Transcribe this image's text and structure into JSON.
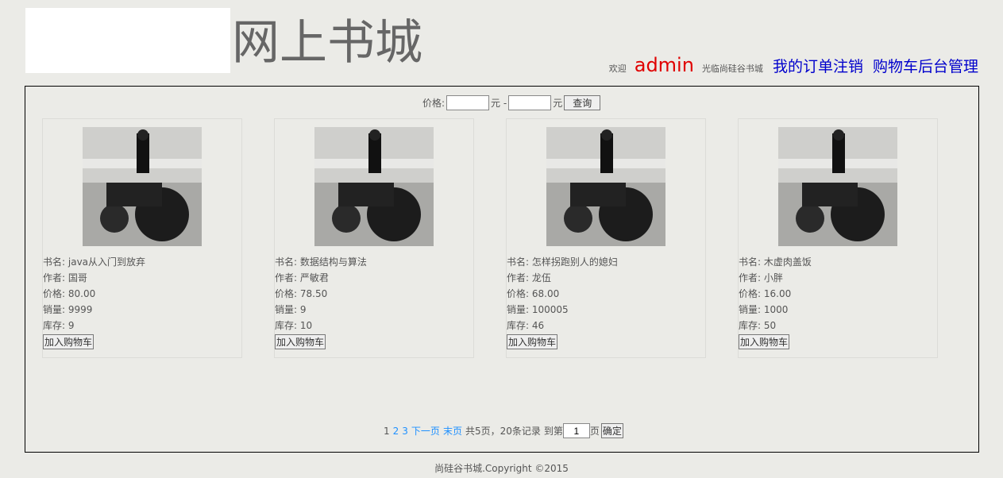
{
  "header": {
    "site_title": "网上书城",
    "welcome": "欢迎",
    "username": "admin",
    "greeting": "光临尚硅谷书城",
    "links": [
      "我的订单",
      "注销",
      "购物车",
      "后台管理"
    ]
  },
  "price_filter": {
    "label": "价格:",
    "min_value": "",
    "currency1": "元 -",
    "max_value": "",
    "currency2": "元",
    "search_button": "查询"
  },
  "books": [
    {
      "name_label": "书名:",
      "name": "java从入门到放弃",
      "author_label": "作者:",
      "author": "国哥",
      "price_label": "价格:",
      "price": "80.00",
      "sales_label": "销量:",
      "sales": "9999",
      "stock_label": "库存:",
      "stock": "9",
      "add_button": "加入购物车"
    },
    {
      "name_label": "书名:",
      "name": "数据结构与算法",
      "author_label": "作者:",
      "author": "严敏君",
      "price_label": "价格:",
      "price": "78.50",
      "sales_label": "销量:",
      "sales": "9",
      "stock_label": "库存:",
      "stock": "10",
      "add_button": "加入购物车"
    },
    {
      "name_label": "书名:",
      "name": "怎样拐跑别人的媳妇",
      "author_label": "作者:",
      "author": "龙伍",
      "price_label": "价格:",
      "price": "68.00",
      "sales_label": "销量:",
      "sales": "100005",
      "stock_label": "库存:",
      "stock": "46",
      "add_button": "加入购物车"
    },
    {
      "name_label": "书名:",
      "name": "木虚肉盖饭",
      "author_label": "作者:",
      "author": "小胖",
      "price_label": "价格:",
      "price": "16.00",
      "sales_label": "销量:",
      "sales": "1000",
      "stock_label": "库存:",
      "stock": "50",
      "add_button": "加入购物车"
    }
  ],
  "pager": {
    "current": "1",
    "page2": "2",
    "page3": "3",
    "next": "下一页",
    "last": "末页",
    "summary": "共5页，20条记录",
    "goto_label": "到第",
    "goto_value": "1",
    "page_unit": "页",
    "confirm": "确定"
  },
  "footer": {
    "copyright": "尚硅谷书城.Copyright ©2015"
  },
  "colors": {
    "background": "#ebebe7",
    "username": "#e00000",
    "nav_link": "#0000cc",
    "pager_link": "#1e90ff"
  }
}
